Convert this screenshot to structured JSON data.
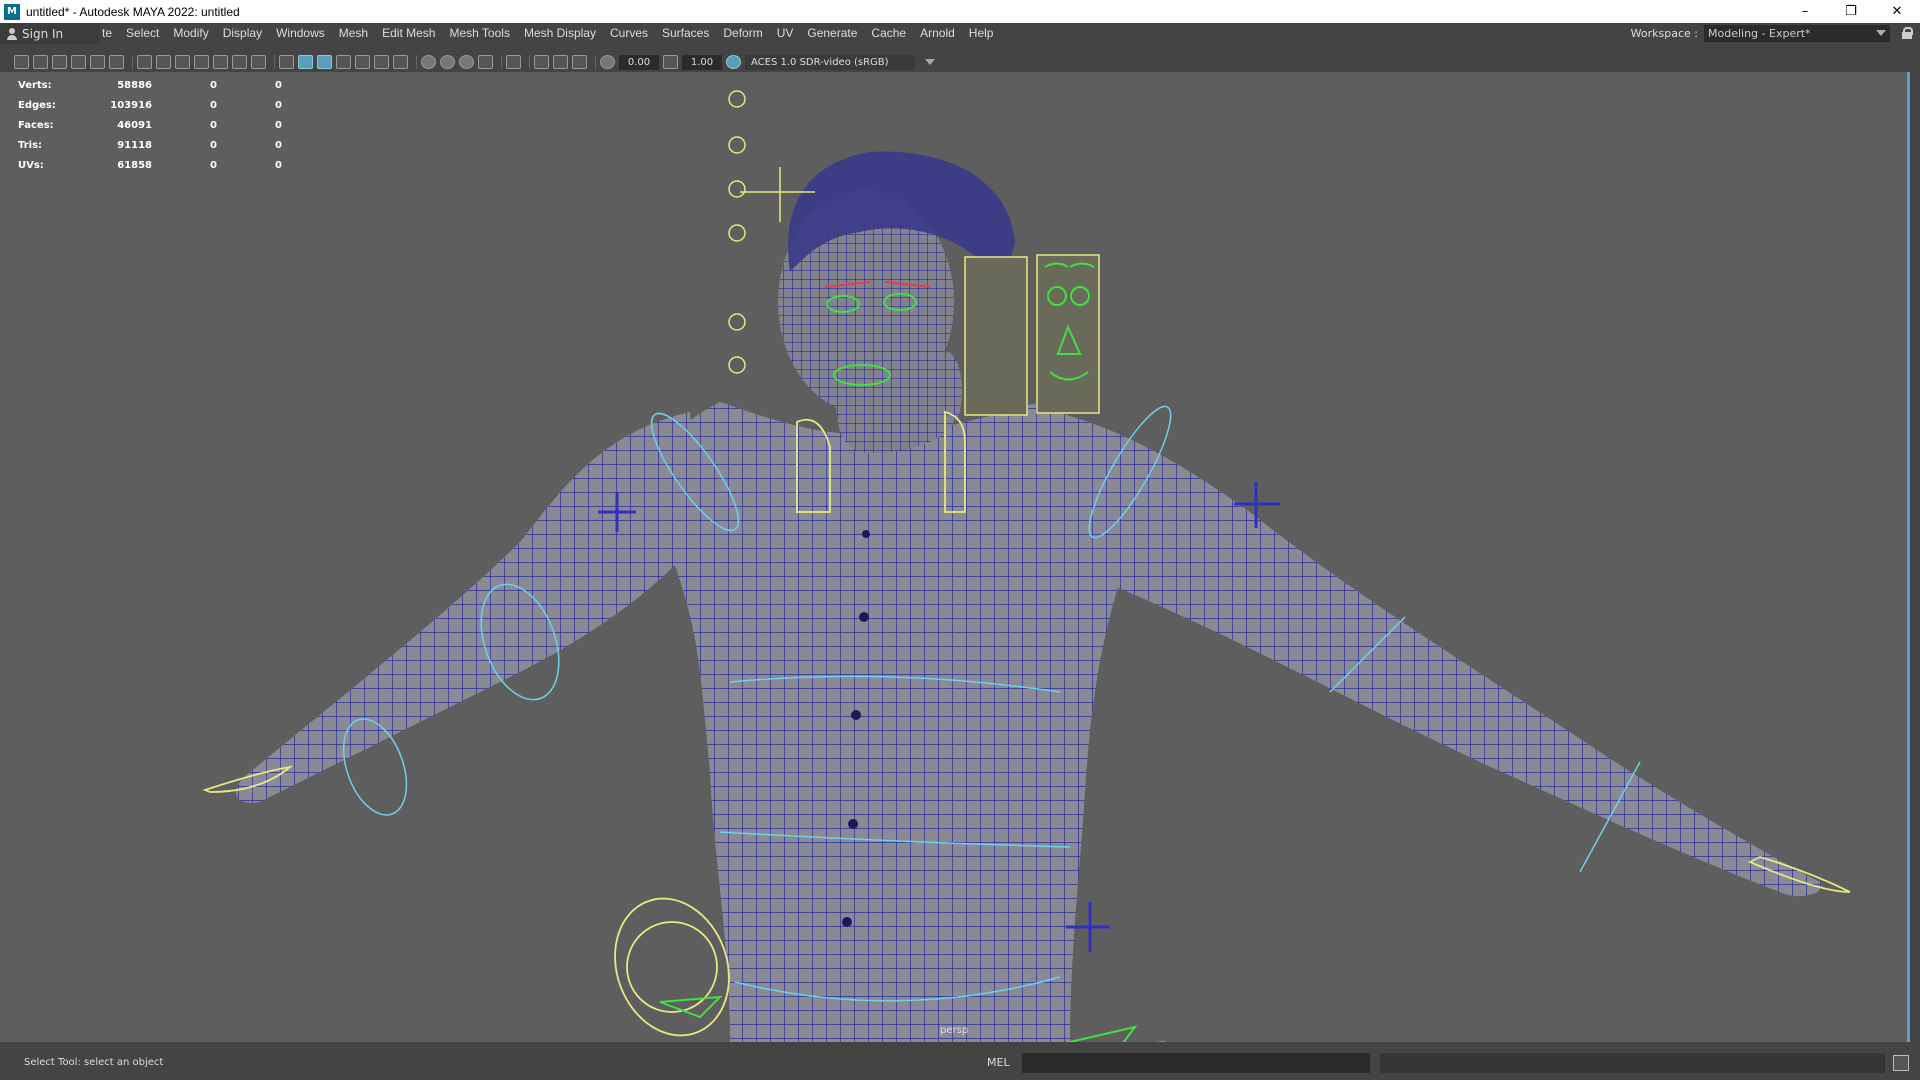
{
  "window": {
    "title": "untitled* - Autodesk MAYA 2022: untitled",
    "app_icon": "M",
    "buttons": [
      "minimize-icon",
      "restore-icon",
      "close-icon"
    ],
    "minimize_glyph": "–",
    "restore_glyph": "❐",
    "close_glyph": "✕"
  },
  "menubar": {
    "sign_in": "Sign In",
    "items": [
      "te",
      "Select",
      "Modify",
      "Display",
      "Windows",
      "Mesh",
      "Edit Mesh",
      "Mesh Tools",
      "Mesh Display",
      "Curves",
      "Surfaces",
      "Deform",
      "UV",
      "Generate",
      "Cache",
      "Arnold",
      "Help"
    ],
    "workspace_label": "Workspace :",
    "workspace_value": "Modeling - Expert*"
  },
  "toolbar": {
    "exposure": "0.00",
    "gamma": "1.00",
    "color_management": "ACES 1.0 SDR-video (sRGB)"
  },
  "heads_up": {
    "rows": [
      {
        "label": "Verts:",
        "v1": "58886",
        "v2": "0",
        "v3": "0"
      },
      {
        "label": "Edges:",
        "v1": "103916",
        "v2": "0",
        "v3": "0"
      },
      {
        "label": "Faces:",
        "v1": "46091",
        "v2": "0",
        "v3": "0"
      },
      {
        "label": "Tris:",
        "v1": "91118",
        "v2": "0",
        "v3": "0"
      },
      {
        "label": "UVs:",
        "v1": "61858",
        "v2": "0",
        "v3": "0"
      }
    ],
    "camera": "persp"
  },
  "statusbar": {
    "help": "Select Tool: select an object",
    "command_language": "MEL"
  },
  "colors": {
    "viewport_bg": "#5e5e5e",
    "wireframe": "#1a1a9a",
    "mesh_fill": "#8a8a94",
    "control_yellow": "#e8e880",
    "control_cyan": "#6fd0e8",
    "control_green": "#40e040"
  }
}
